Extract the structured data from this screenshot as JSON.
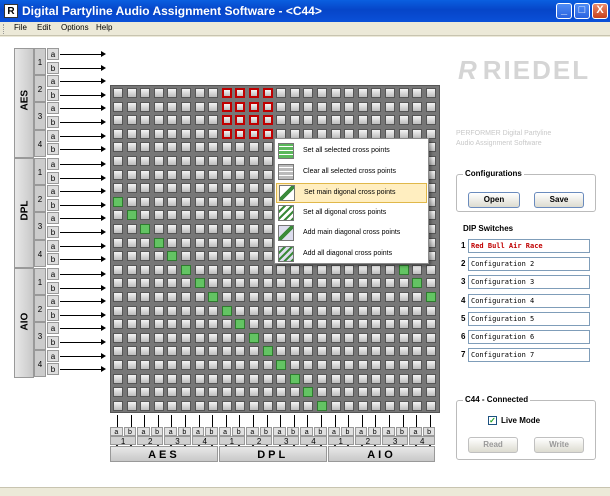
{
  "window": {
    "icon_letter": "R",
    "title": "Digital Partyline Audio Assignment Software - <C44>",
    "buttons": {
      "minimize": "_",
      "maximize": "□",
      "close": "X"
    }
  },
  "menu": [
    {
      "label": "File"
    },
    {
      "label": "Edit"
    },
    {
      "label": "Options"
    },
    {
      "label": "Help"
    }
  ],
  "matrix": {
    "groups": [
      "AES",
      "DPL",
      "AIO"
    ],
    "port_numbers": [
      "1",
      "2",
      "3",
      "4"
    ],
    "sub_labels": [
      "a",
      "b"
    ],
    "size": 24,
    "highlight_color": "#63c463",
    "selection_color": "#c00000"
  },
  "context_menu": {
    "items": [
      {
        "label": "Set all selected cross points",
        "icon": "grid-fill-icon"
      },
      {
        "label": "Clear all selected cross points",
        "icon": "grid-clear-icon"
      },
      {
        "label": "Set main digonal cross points",
        "icon": "diagonal-icon"
      },
      {
        "label": "Set all digonal cross points",
        "icon": "diagonal-all-icon"
      },
      {
        "label": "Add main diagonal cross points",
        "icon": "diagonal-add-icon"
      },
      {
        "label": "Add all diagonal cross points",
        "icon": "diagonal-add-all-icon"
      }
    ],
    "highlighted_index": 2
  },
  "brand": {
    "logo_mark": "R",
    "logo_text": "RIEDEL",
    "subtitle_line1": "PERFORMER Digital Partyline",
    "subtitle_line2": "Audio Assignment Software"
  },
  "configurations": {
    "title": "Configurations",
    "open_label": "Open",
    "save_label": "Save"
  },
  "dip": {
    "title": "DIP Switches",
    "entries": [
      {
        "num": "1",
        "name": "Red Bull Air Race"
      },
      {
        "num": "2",
        "name": "Configuration 2"
      },
      {
        "num": "3",
        "name": "Configuration 3"
      },
      {
        "num": "4",
        "name": "Configuration 4"
      },
      {
        "num": "5",
        "name": "Configuration 5"
      },
      {
        "num": "6",
        "name": "Configuration 6"
      },
      {
        "num": "7",
        "name": "Configuration 7"
      }
    ]
  },
  "connection": {
    "title": "C44 - Connected",
    "live_mode_label": "Live Mode",
    "live_mode_checked": "✓",
    "read_label": "Read",
    "write_label": "Write"
  }
}
